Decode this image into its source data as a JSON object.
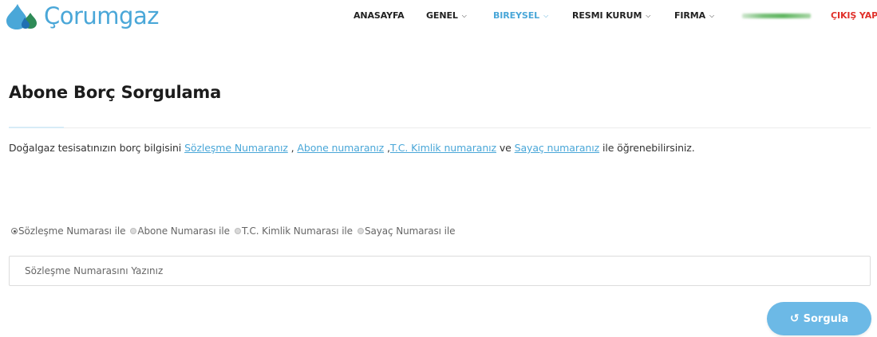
{
  "brand": {
    "name": "Çorumgaz",
    "colors": {
      "primary": "#4aa7d8",
      "logout": "#e0312b",
      "button": "#6cb9e6",
      "logo_drop_dark": "#1f6fb2",
      "logo_drop_green": "#2e8b57"
    }
  },
  "nav": {
    "items": [
      {
        "label": "ANASAYFA",
        "has_dropdown": false,
        "active": false
      },
      {
        "label": "GENEL",
        "has_dropdown": true,
        "active": false
      },
      {
        "label": "BIREYSEL",
        "has_dropdown": true,
        "active": true
      },
      {
        "label": "RESMI KURUM",
        "has_dropdown": true,
        "active": false
      },
      {
        "label": "FIRMA",
        "has_dropdown": true,
        "active": false
      }
    ],
    "logout_label": "ÇIKIŞ YAP",
    "dropdown_icon": "chevron-down-icon"
  },
  "page": {
    "title": "Abone Borç Sorgulama",
    "intro": {
      "prefix": "Doğalgaz tesisatınızın borç bilgisini ",
      "link_1": "Sözleşme Numaranız",
      "sep_1": " , ",
      "link_2": "Abone numaranız",
      "sep_2": " ,",
      "link_3": "T.C. Kimlik numaranız",
      "sep_3": " ve ",
      "link_4": "Sayaç numaranız",
      "suffix": " ile öğrenebilirsiniz."
    }
  },
  "form": {
    "options": [
      {
        "label": "Sözleşme Numarası ile",
        "checked": true
      },
      {
        "label": "Abone Numarası ile",
        "checked": false
      },
      {
        "label": "T.C. Kimlik Numarası ile",
        "checked": false
      },
      {
        "label": "Sayaç Numarası ile",
        "checked": false
      }
    ],
    "input": {
      "value": "",
      "placeholder": "Sözleşme Numarasını Yazınız"
    },
    "submit": {
      "label": "Sorgula",
      "icon": "refresh-icon"
    }
  }
}
